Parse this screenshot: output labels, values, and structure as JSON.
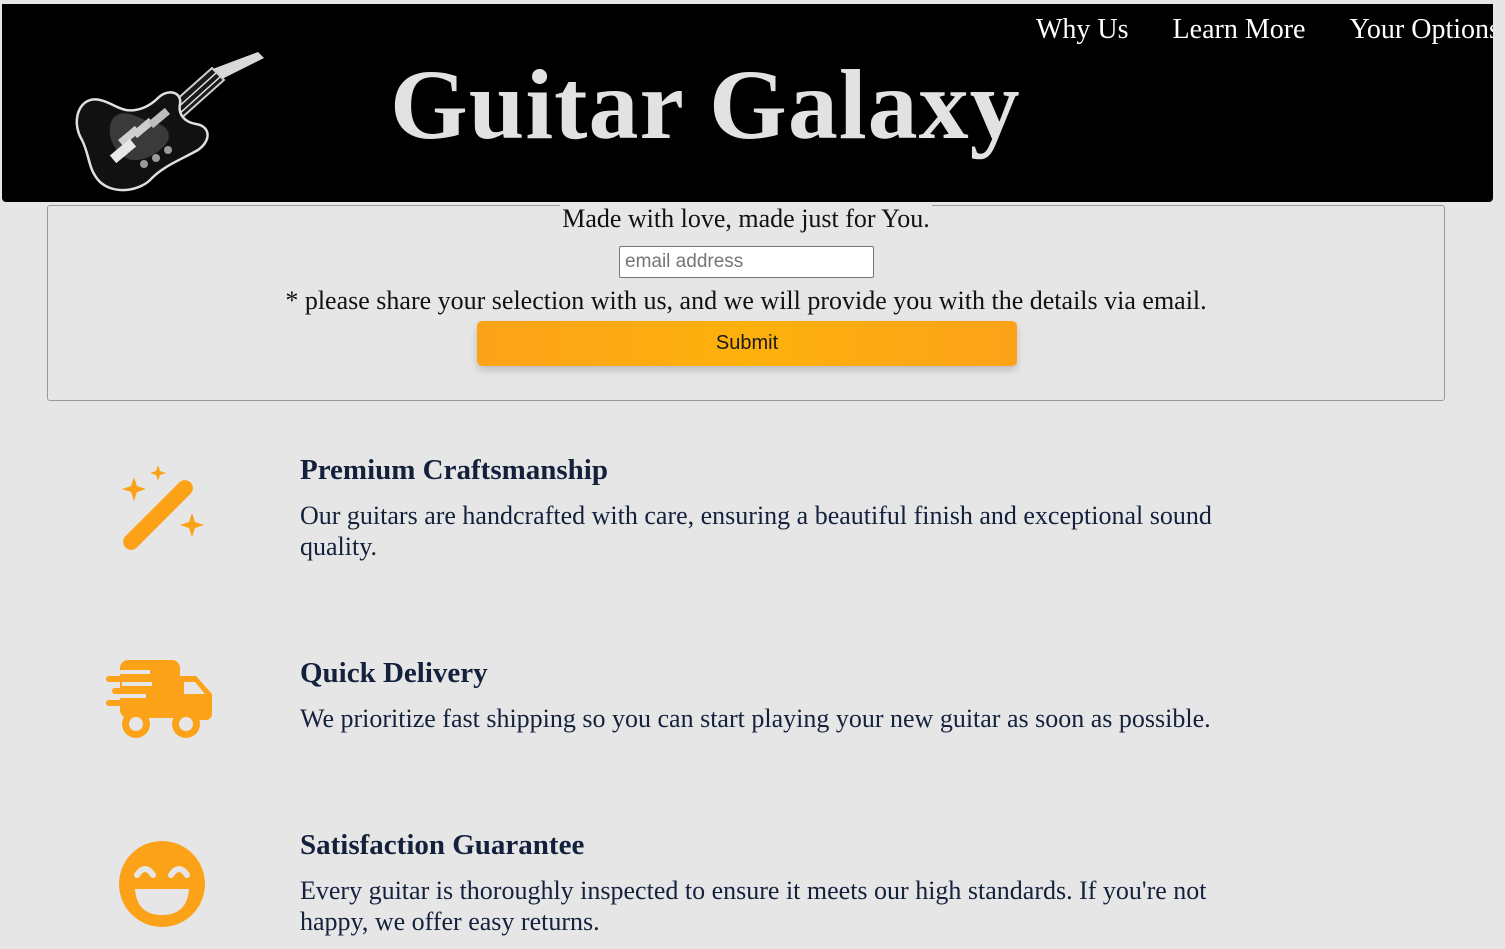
{
  "header": {
    "site_title": "Guitar Galaxy",
    "nav": [
      {
        "label": "Why Us"
      },
      {
        "label": "Learn More"
      },
      {
        "label": "Your Options"
      }
    ]
  },
  "signup": {
    "legend": "Made with love, made just for You.",
    "email_placeholder": "email address",
    "email_value": "",
    "note": "* please share your selection with us, and we will provide you with the details via email.",
    "submit_label": "Submit"
  },
  "features": [
    {
      "icon": "magic-wand-icon",
      "title": "Premium Craftsmanship",
      "text": "Our guitars are handcrafted with care, ensuring a beautiful finish and exceptional sound quality."
    },
    {
      "icon": "delivery-truck-icon",
      "title": "Quick Delivery",
      "text": "We prioritize fast shipping so you can start playing your new guitar as soon as possible."
    },
    {
      "icon": "smiley-face-icon",
      "title": "Satisfaction Guarantee",
      "text": "Every guitar is thoroughly inspected to ensure it meets our high standards. If you're not happy, we offer easy returns."
    }
  ],
  "colors": {
    "header_bg": "#000000",
    "page_bg": "#e7e6e6",
    "accent": "#fca219",
    "heading_text": "#14213d"
  }
}
